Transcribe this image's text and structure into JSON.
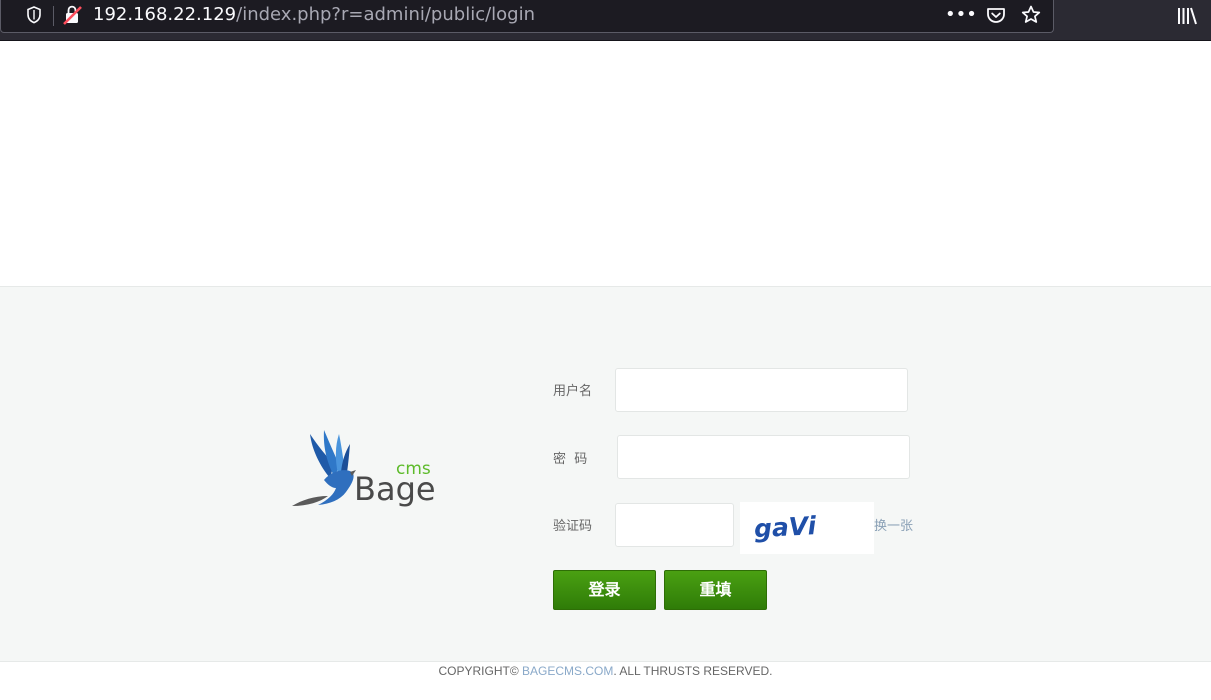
{
  "browser": {
    "url_host": "192.168.22.129",
    "url_path": "/index.php?r=admini/public/login",
    "more_label": "•••",
    "icons": [
      "shield-icon",
      "insecure-connection-icon",
      "more-icon",
      "pocket-icon",
      "star-icon",
      "library-icon"
    ]
  },
  "logo": {
    "brand": "Bage",
    "brand_suffix": "cms"
  },
  "form": {
    "username_label": "用户名",
    "username_value": "",
    "password_label": "密  码",
    "password_value": "",
    "captcha_label": "验证码",
    "captcha_value": "",
    "captcha_text": "gaVi",
    "refresh_captcha_label": "换一张",
    "login_button": "登录",
    "reset_button": "重填"
  },
  "footer": {
    "copyright_prefix": "COPYRIGHT© ",
    "copyright_site": "BAGECMS.COM",
    "copyright_suffix": ". ALL THRUSTS RESERVED."
  },
  "colors": {
    "chrome_bg": "#2b2a33",
    "urlbar_bg": "#1c1b22",
    "band_bg": "#f5f7f6",
    "button_green": "#3b8f0d",
    "logo_green": "#5dbb2a",
    "captcha_blue": "#1f4fa8"
  }
}
